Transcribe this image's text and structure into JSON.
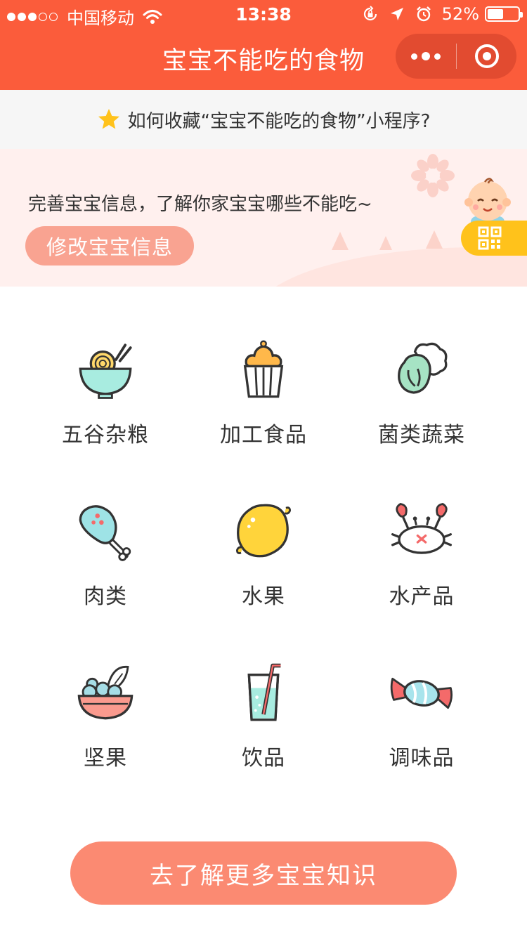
{
  "status_bar": {
    "carrier": "中国移动",
    "time": "13:38",
    "battery_percent": "52%",
    "battery_level": 0.52
  },
  "nav": {
    "title": "宝宝不能吃的食物"
  },
  "tip": {
    "text": "如何收藏“宝宝不能吃的食物”小程序?"
  },
  "banner": {
    "text": "完善宝宝信息，了解你家宝宝哪些不能吃~",
    "button": "修改宝宝信息"
  },
  "categories": [
    {
      "label": "五谷杂粮",
      "icon": "noodle-bowl-icon"
    },
    {
      "label": "加工食品",
      "icon": "cupcake-icon"
    },
    {
      "label": "菌类蔬菜",
      "icon": "broccoli-icon"
    },
    {
      "label": "肉类",
      "icon": "drumstick-icon"
    },
    {
      "label": "水果",
      "icon": "lemon-icon"
    },
    {
      "label": "水产品",
      "icon": "crab-icon"
    },
    {
      "label": "坚果",
      "icon": "nut-bowl-icon"
    },
    {
      "label": "饮品",
      "icon": "drink-icon"
    },
    {
      "label": "调味品",
      "icon": "candy-icon"
    }
  ],
  "footer": {
    "button": "去了解更多宝宝知识"
  },
  "colors": {
    "brand": "#fb5c3b",
    "banner_button": "#f9a391",
    "footer_button": "#fb8a72",
    "star": "#ffc21b"
  }
}
